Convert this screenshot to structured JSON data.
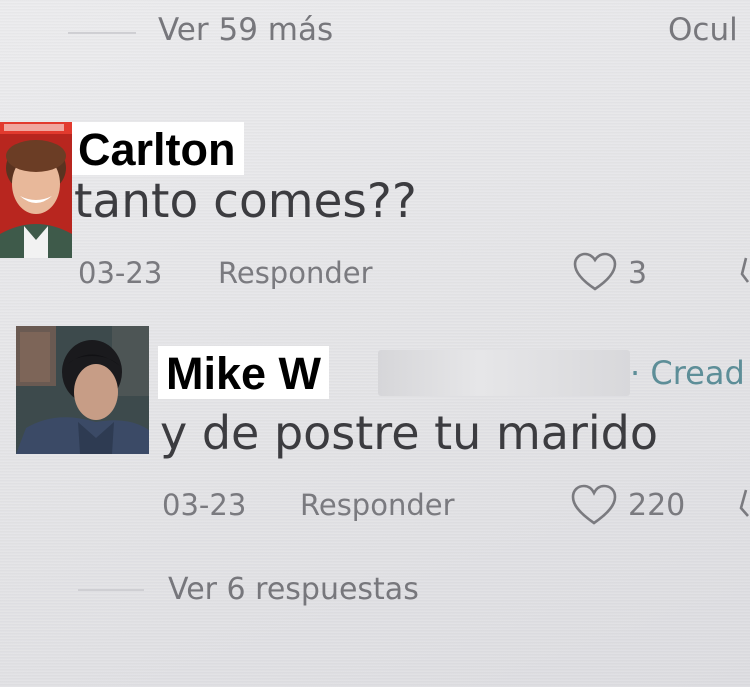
{
  "top": {
    "view_more": "Ver 59 más",
    "hide": "Ocul"
  },
  "comments": [
    {
      "name": "Carlton",
      "text": "tanto comes??",
      "date": "03-23",
      "reply": "Responder",
      "likes": "3"
    },
    {
      "name": "Mike W",
      "creator_tag": "· Cread",
      "text": "y de postre tu marido",
      "date": "03-23",
      "reply": "Responder",
      "likes": "220",
      "view_replies": "Ver 6 respuestas"
    }
  ],
  "colors": {
    "background": "#e7e7e9",
    "muted_text": "#77777c",
    "creator_accent": "#5d8e98"
  },
  "icons": [
    "heart-icon",
    "dislike-icon"
  ]
}
